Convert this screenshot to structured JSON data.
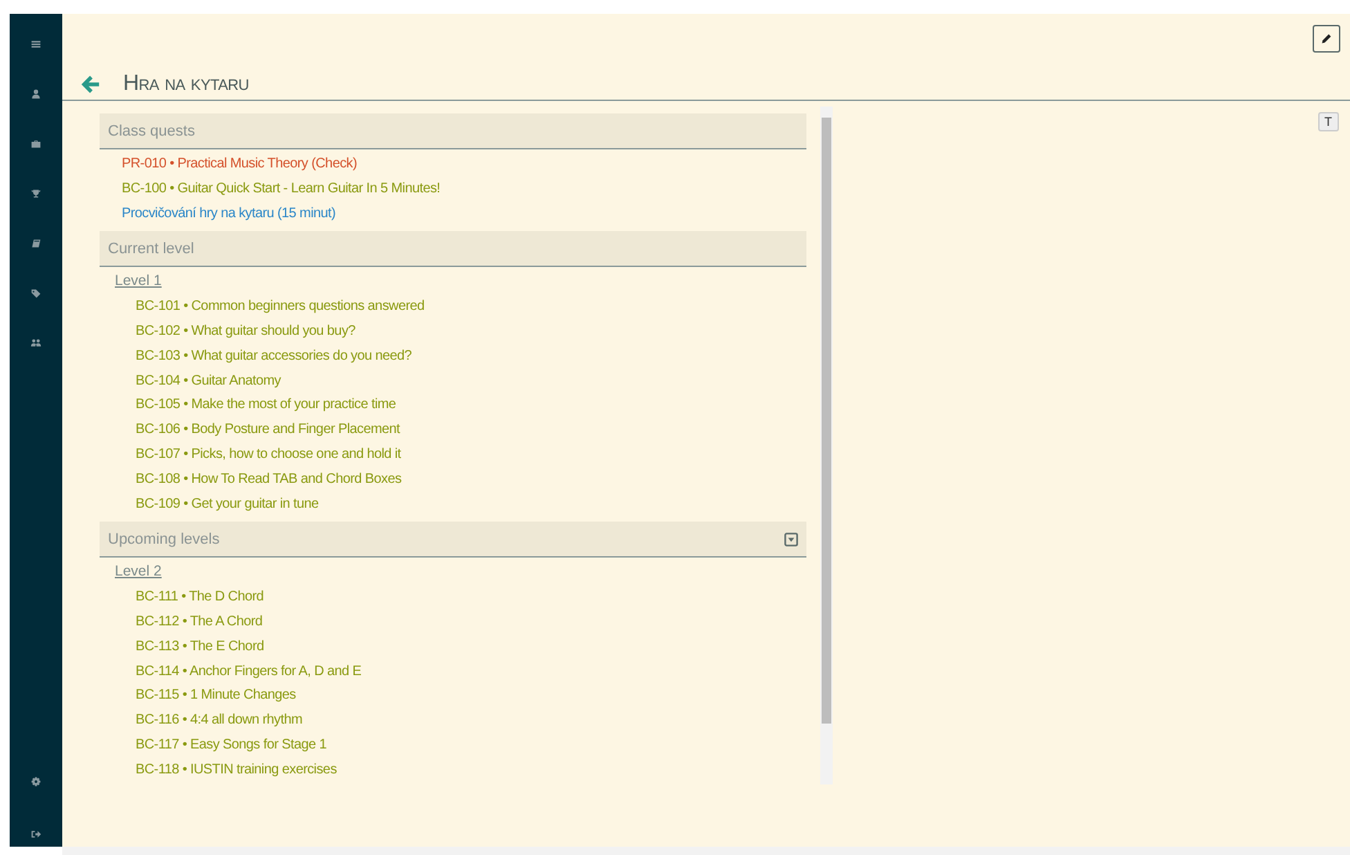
{
  "page": {
    "title": "Hra na kytaru",
    "edit_button": {
      "kind": "pencil"
    },
    "text_button": "T"
  },
  "sections": [
    {
      "title": "Class quests",
      "collapsible": false,
      "quests": [
        {
          "label": "PR-010 • Practical Music Theory (Check)",
          "color": "#d4502a"
        },
        {
          "label": "BC-100 • Guitar Quick Start - Learn Guitar In 5 Minutes!",
          "color": "#8a9a10"
        },
        {
          "label": "Procvičování hry na kytaru (15 minut)",
          "color": "#2a86c8"
        }
      ]
    },
    {
      "title": "Current level",
      "collapsible": false,
      "levels": [
        {
          "title": "Level 1",
          "quests": [
            {
              "label": "BC-101 • Common beginners questions answered",
              "color": "#8a9a10"
            },
            {
              "label": "BC-102 • What guitar should you buy?",
              "color": "#8a9a10"
            },
            {
              "label": "BC-103 • What guitar accessories do you need?",
              "color": "#8a9a10"
            },
            {
              "label": "BC-104 • Guitar Anatomy",
              "color": "#8a9a10"
            },
            {
              "label": "BC-105 • Make the most of your practice time",
              "color": "#8a9a10"
            },
            {
              "label": "BC-106 • Body Posture and Finger Placement",
              "color": "#8a9a10"
            },
            {
              "label": "BC-107 • Picks, how to choose one and hold it",
              "color": "#8a9a10"
            },
            {
              "label": "BC-108 • How To Read TAB and Chord Boxes",
              "color": "#8a9a10"
            },
            {
              "label": "BC-109 • Get your guitar in tune",
              "color": "#8a9a10"
            }
          ]
        }
      ]
    },
    {
      "title": "Upcoming levels",
      "collapsible": true,
      "levels": [
        {
          "title": "Level 2",
          "quests": [
            {
              "label": "BC-111 • The D Chord",
              "color": "#8a9a10"
            },
            {
              "label": "BC-112 • The A Chord",
              "color": "#8a9a10"
            },
            {
              "label": "BC-113 • The E Chord",
              "color": "#8a9a10"
            },
            {
              "label": "BC-114 • Anchor Fingers for A, D and E",
              "color": "#8a9a10"
            },
            {
              "label": "BC-115 • 1 Minute Changes",
              "color": "#8a9a10"
            },
            {
              "label": "BC-116 • 4:4 all down rhythm",
              "color": "#8a9a10"
            },
            {
              "label": "BC-117 • Easy Songs for Stage 1",
              "color": "#8a9a10"
            },
            {
              "label": "BC-118 • IUSTIN training exercises",
              "color": "#8a9a10"
            }
          ]
        }
      ]
    }
  ]
}
